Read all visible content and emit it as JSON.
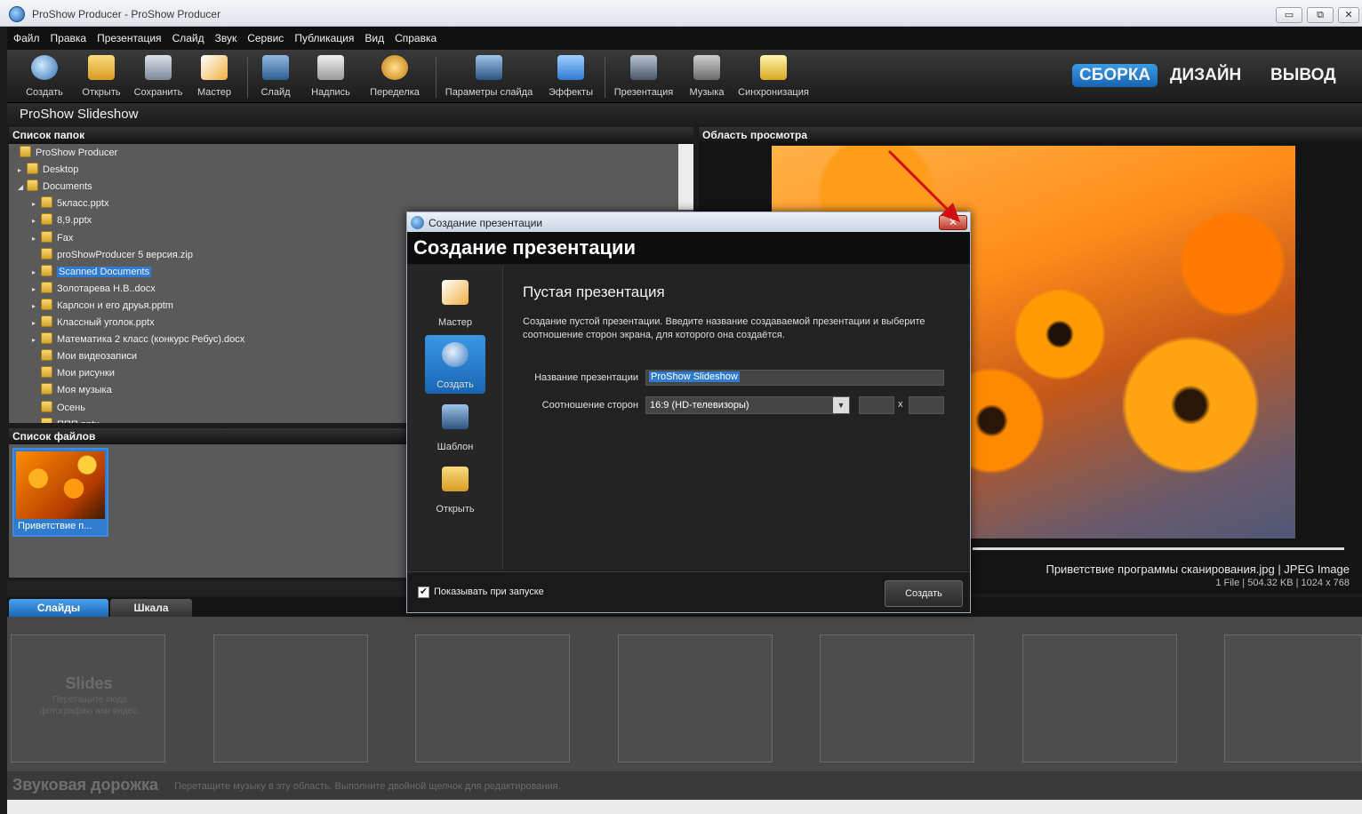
{
  "window": {
    "title": "ProShow Producer - ProShow Producer",
    "minimize": "▭",
    "restore": "⧉",
    "close": "✕"
  },
  "menu": [
    "Файл",
    "Правка",
    "Презентация",
    "Слайд",
    "Звук",
    "Сервис",
    "Публикация",
    "Вид",
    "Справка"
  ],
  "toolbar": {
    "buttons": [
      {
        "label": "Создать",
        "icon": "create-icon"
      },
      {
        "label": "Открыть",
        "icon": "open-folder-icon"
      },
      {
        "label": "Сохранить",
        "icon": "save-icon"
      },
      {
        "label": "Мастер",
        "icon": "wizard-icon"
      },
      {
        "label": "Слайд",
        "icon": "add-slide-icon"
      },
      {
        "label": "Надпись",
        "icon": "caption-icon"
      },
      {
        "label": "Переделка",
        "icon": "remix-icon"
      },
      {
        "label": "Параметры слайда",
        "icon": "slide-options-icon"
      },
      {
        "label": "Эффекты",
        "icon": "effects-icon"
      },
      {
        "label": "Презентация",
        "icon": "show-options-icon"
      },
      {
        "label": "Музыка",
        "icon": "music-icon"
      },
      {
        "label": "Синхронизация",
        "icon": "sync-icon"
      }
    ],
    "modes": [
      "СБОРКА",
      "ДИЗАЙН",
      "ВЫВОД"
    ],
    "accent": "#1f72c4"
  },
  "project": {
    "name": "ProShow Slideshow"
  },
  "folder_panel": {
    "title": "Список папок",
    "items": [
      {
        "label": "ProShow Producer",
        "arrow": ""
      },
      {
        "label": "Desktop",
        "arrow": "▸"
      },
      {
        "label": "Documents",
        "arrow": "◢"
      },
      {
        "label": "5класс.pptx",
        "arrow": "▸"
      },
      {
        "label": "8,9.pptx",
        "arrow": "▸"
      },
      {
        "label": "Fax",
        "arrow": "▸"
      },
      {
        "label": "proShowProducer 5 версия.zip",
        "arrow": ""
      },
      {
        "label": "Scanned Documents",
        "arrow": "▸"
      },
      {
        "label": "Золотарева Н.В..docx",
        "arrow": "▸"
      },
      {
        "label": "Карлсон и его друья.pptm",
        "arrow": "▸"
      },
      {
        "label": "Классный уголок.pptx",
        "arrow": "▸"
      },
      {
        "label": "Математика 2 класс (конкурс Ребус).docx",
        "arrow": "▸"
      },
      {
        "label": "Мои видеозаписи",
        "arrow": ""
      },
      {
        "label": "Мои рисунки",
        "arrow": ""
      },
      {
        "label": "Моя музыка",
        "arrow": ""
      },
      {
        "label": "Осень",
        "arrow": ""
      },
      {
        "label": "ППП.pptx",
        "arrow": "▸"
      }
    ]
  },
  "file_panel": {
    "title": "Список файлов",
    "thumb_caption": "Приветствие п..."
  },
  "preview": {
    "title": "Область просмотра",
    "info_line": "Приветствие программы сканирования.jpg  |  JPEG Image",
    "meta_line": "1 File  |  504.32 KB  |  1024 x 768"
  },
  "tabs": [
    "Слайды",
    "Шкала"
  ],
  "slides": {
    "placeholder_title": "Slides",
    "placeholder_hint": "Перетащите сюда фотографию или видео."
  },
  "audio": {
    "title": "Звуковая дорожка",
    "hint": "Перетащите музыку в эту область. Выполните двойной щелчок для редактирования."
  },
  "dialog": {
    "title_small": "Создание презентации",
    "title": "Создание презентации",
    "close": "✕",
    "side": [
      {
        "label": "Мастер",
        "icon": "wizard-icon"
      },
      {
        "label": "Создать",
        "icon": "create-icon"
      },
      {
        "label": "Шаблон",
        "icon": "template-icon"
      },
      {
        "label": "Открыть",
        "icon": "open-folder-icon"
      }
    ],
    "heading": "Пустая презентация",
    "description": "Создание пустой презентации. Введите название создаваемой презентации и выберите соотношение сторон экрана, для которого она создаётся.",
    "name_label": "Название презентации",
    "name_value": "ProShow Slideshow",
    "aspect_label": "Соотношение сторон",
    "aspect_value": "16:9 (HD-телевизоры)",
    "ratio_sep": "x",
    "show_on_start": "Показывать при запуске",
    "checkmark": "✔",
    "create_button": "Создать"
  }
}
